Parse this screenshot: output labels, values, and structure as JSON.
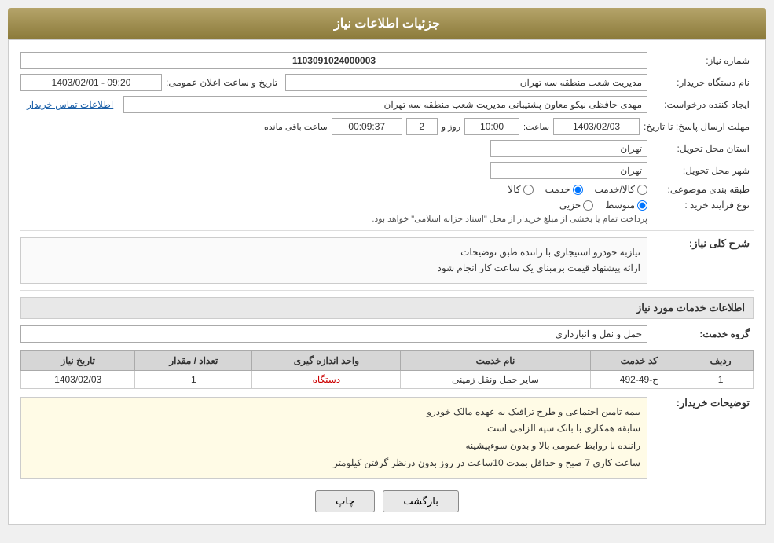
{
  "header": {
    "title": "جزئیات اطلاعات نیاز"
  },
  "fields": {
    "shomareNiaz_label": "شماره نیاز:",
    "shomareNiaz_value": "1103091024000003",
    "namDastgah_label": "نام دستگاه خریدار:",
    "namDastgah_value": "مدیریت شعب منطقه سه تهران",
    "tarikh_label": "تاریخ و ساعت اعلان عمومی:",
    "tarikh_value": "1403/02/01 - 09:20",
    "ijadKonande_label": "ایجاد کننده درخواست:",
    "ijadKonande_value": "مهدی حافظی نیکو معاون پشتیبانی مدیریت شعب منطقه سه تهران",
    "etelaatTamas_label": "اطلاعات تماس خریدار",
    "mohlat_label": "مهلت ارسال پاسخ: تا تاریخ:",
    "mohlat_date": "1403/02/03",
    "mohlat_saat_label": "ساعت:",
    "mohlat_saat_value": "10:00",
    "mohlat_roz_label": "روز و",
    "mohlat_roz_value": "2",
    "mohlat_baghi_label": "ساعت باقی مانده",
    "mohlat_baghi_value": "00:09:37",
    "ostan_label": "استان محل تحویل:",
    "ostan_value": "تهران",
    "shahr_label": "شهر محل تحویل:",
    "shahr_value": "تهران",
    "tabaghe_label": "طبقه بندی موضوعی:",
    "tabaghe_kala": "کالا",
    "tabaghe_khadamat": "خدمت",
    "tabaghe_kala_khadamat": "کالا/خدمت",
    "tabaghe_selected": "خدمت",
    "noeFarayand_label": "نوع فرآیند خرید :",
    "noeFarayand_jozi": "جزیی",
    "noeFarayand_motavaset": "متوسط",
    "noeFarayand_description": "پرداخت تمام یا بخشی از مبلغ خریدار از محل \"اسناد خزانه اسلامی\" خواهد بود.",
    "noeFarayand_selected": "متوسط"
  },
  "sharhKolliNiaz": {
    "label": "شرح کلی نیاز:",
    "line1": "نیازبه خودرو استیجاری با راننده طبق توضیحات",
    "line2": "ارائه پیشنهاد قیمت برمبنای یک ساعت کار انجام شود"
  },
  "khadamatSection": {
    "header": "اطلاعات خدمات مورد نیاز",
    "grouhKhadamat_label": "گروه خدمت:",
    "grouhKhadamat_value": "حمل و نقل و انبارداری"
  },
  "table": {
    "headers": [
      "ردیف",
      "کد خدمت",
      "نام خدمت",
      "واحد اندازه گیری",
      "تعداد / مقدار",
      "تاریخ نیاز"
    ],
    "rows": [
      {
        "radif": "1",
        "kodKhadamat": "ح-49-492",
        "namKhadamat": "سایر حمل ونقل زمینی",
        "vahed": "دستگاه",
        "tedad": "1",
        "tarikh": "1403/02/03"
      }
    ]
  },
  "tozihatKharidар": {
    "label": "توضیحات خریدار:",
    "line1": "بیمه تامین اجتماعی و طرح ترافیک به عهده مالک خودرو",
    "line2": "سابقه همکاری با بانک سپه الزامی است",
    "line3": "راننده با روابط عمومی بالا و بدون سوءپیشینه",
    "line4": "ساعت کاری 7 صبح و حداقل بمدت 10ساعت در روز بدون درنظر گرفتن کیلومتر"
  },
  "buttons": {
    "chap": "چاپ",
    "bazgasht": "بازگشت"
  }
}
